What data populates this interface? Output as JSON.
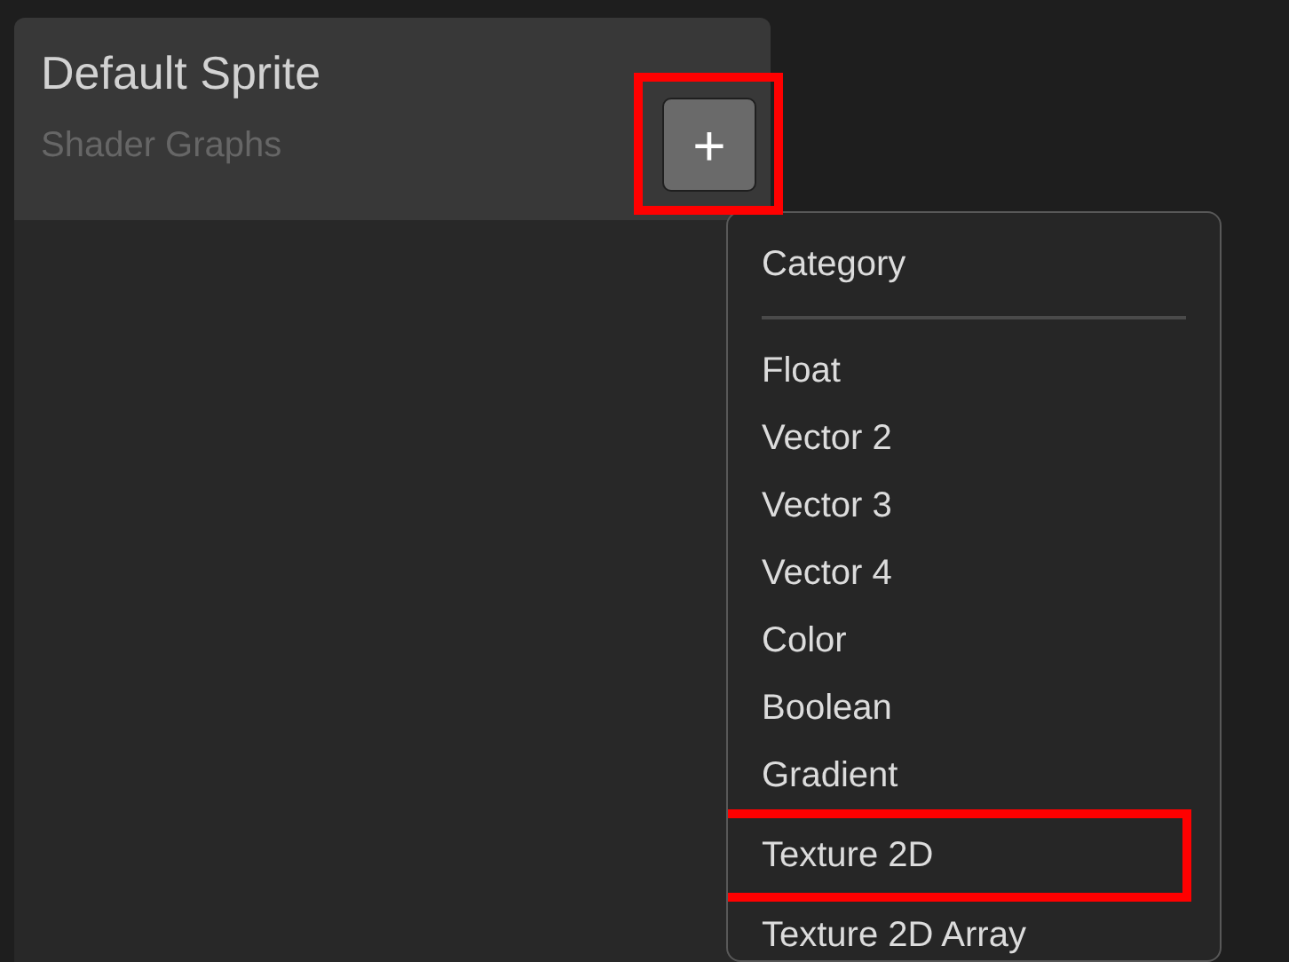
{
  "panel": {
    "title": "Default Sprite",
    "subtitle": "Shader Graphs",
    "add_button": {
      "label": "+",
      "highlighted": true
    }
  },
  "menu": {
    "header": "Category",
    "items": [
      {
        "label": "Float",
        "highlighted": false
      },
      {
        "label": "Vector 2",
        "highlighted": false
      },
      {
        "label": "Vector 3",
        "highlighted": false
      },
      {
        "label": "Vector 4",
        "highlighted": false
      },
      {
        "label": "Color",
        "highlighted": false
      },
      {
        "label": "Boolean",
        "highlighted": false
      },
      {
        "label": "Gradient",
        "highlighted": false
      },
      {
        "label": "Texture 2D",
        "highlighted": true
      },
      {
        "label": "Texture 2D Array",
        "highlighted": false
      }
    ]
  }
}
